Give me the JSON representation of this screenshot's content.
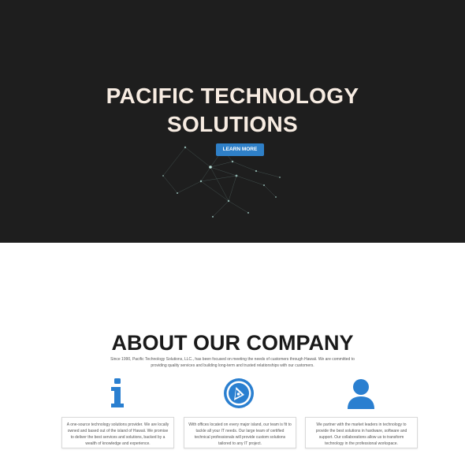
{
  "hero": {
    "title_line1": "PACIFIC TECHNOLOGY",
    "title_line2": "SOLUTIONS",
    "button_label": "LEARN MORE"
  },
  "about": {
    "title": "ABOUT OUR COMPANY",
    "intro": "Since 1990, Pacific Technology Solutions, LLC., has been focused on meeting the needs of customers through Hawaii. We are committed to providing quality services and building long-term and trusted relationships with our customers.",
    "features": [
      {
        "icon": "info-icon",
        "text": "A one-source technology solutions provider. We are locally owned and based out of the island of Hawaii. We promise to deliver the best services and solutions, backed by a wealth of knowledge and experience."
      },
      {
        "icon": "compass-icon",
        "text": "With offices located on every major island, our team is fit to tackle all your IT needs. Our large team of certified technical professionals will provide custom solutions tailored to any IT project."
      },
      {
        "icon": "user-icon",
        "text": "We partner with the market leaders in technology to provide the best solutions in hardware, software and support. Our collaborations allow us to transform technology in the professional workspace."
      }
    ]
  },
  "colors": {
    "hero_background": "#1e1e1e",
    "accent_blue": "#2f80c8",
    "title_cream": "#f7ece2",
    "icon_blue": "#2a7fd0"
  }
}
